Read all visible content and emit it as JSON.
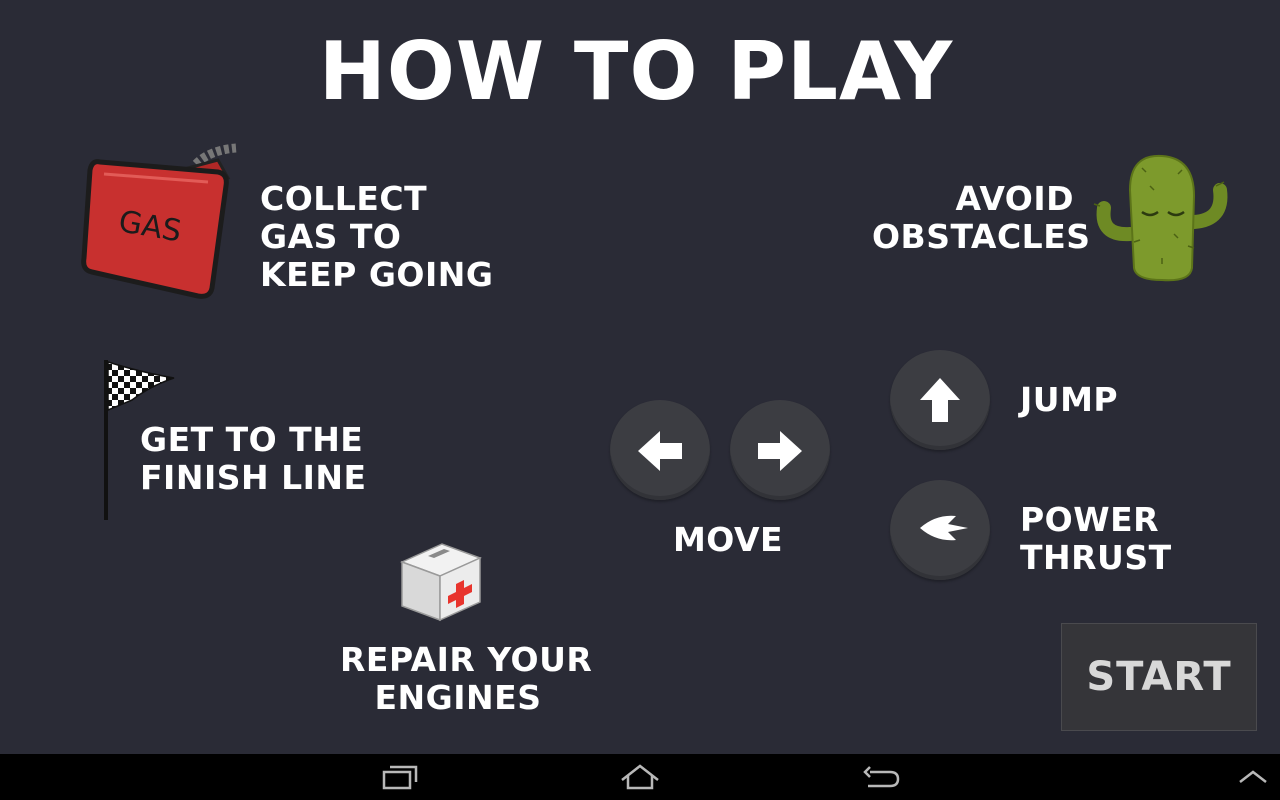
{
  "title": "HOW TO PLAY",
  "instructions": {
    "gas": [
      "COLLECT",
      "GAS TO",
      "KEEP GOING"
    ],
    "gas_can_label": "GAS",
    "finish": [
      "GET TO THE",
      "FINISH LINE"
    ],
    "repair": [
      "REPAIR YOUR",
      "ENGINES"
    ],
    "obstacles": [
      "AVOID",
      "OBSTACLES"
    ]
  },
  "controls": {
    "move_label": "MOVE",
    "jump_label": "JUMP",
    "thrust_label": [
      "POWER",
      "THRUST"
    ],
    "icons": [
      "arrow-left-icon",
      "arrow-right-icon",
      "arrow-up-icon",
      "thrust-icon"
    ]
  },
  "start_label": "START",
  "system_nav": [
    "recent-apps-icon",
    "home-icon",
    "back-icon",
    "chevron-up-icon"
  ],
  "colors": {
    "background": "#2a2b36",
    "button": "#3c3d42",
    "gas_can": "#c8302f",
    "cactus": "#7d9a2c",
    "medkit_cross": "#e8342d"
  }
}
